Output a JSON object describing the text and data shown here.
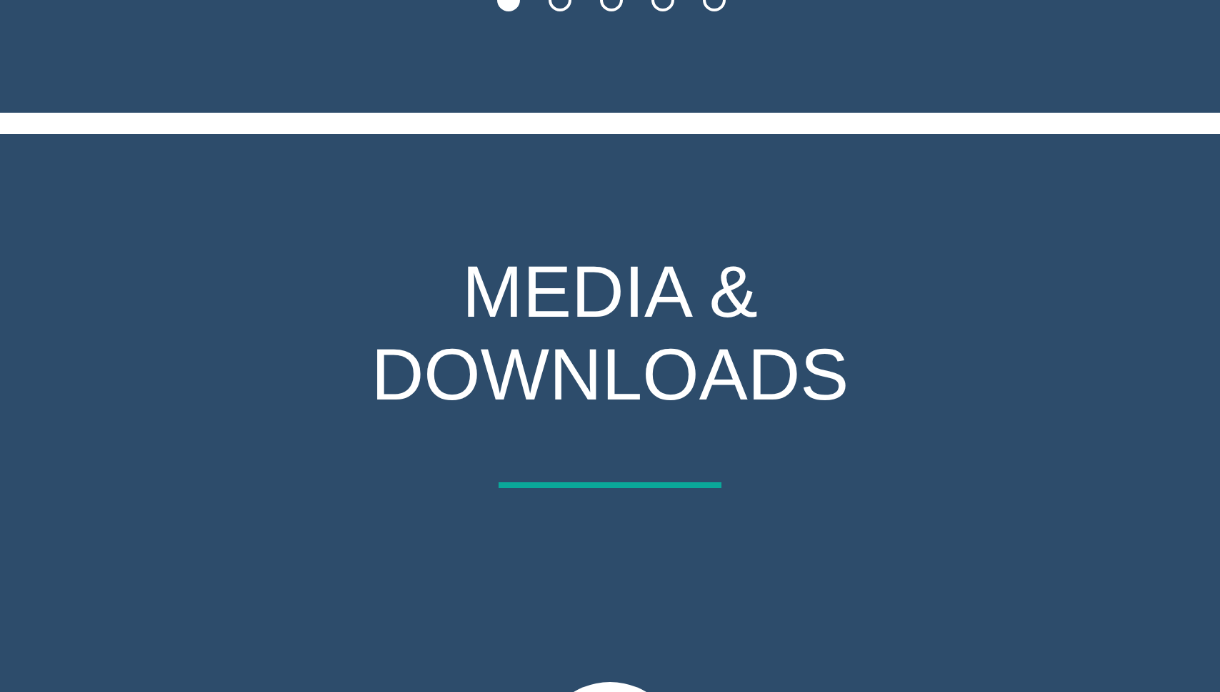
{
  "carousel": {
    "dots": [
      {
        "selected": true
      },
      {
        "selected": false
      },
      {
        "selected": false
      },
      {
        "selected": false
      },
      {
        "selected": false
      }
    ]
  },
  "section": {
    "title_lines": [
      "MEDIA &",
      "DOWNLOADS"
    ]
  }
}
